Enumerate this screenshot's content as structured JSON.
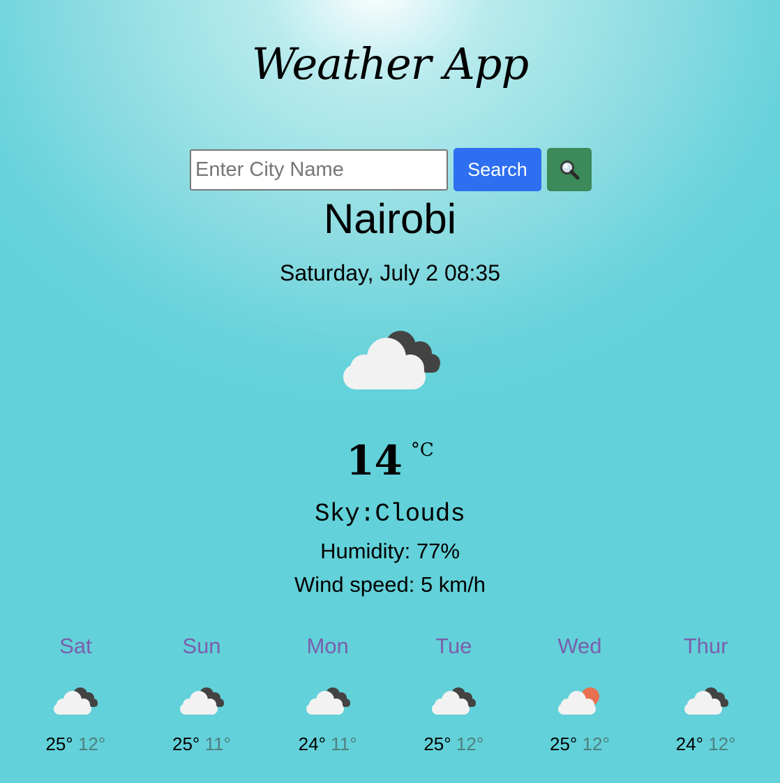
{
  "app": {
    "title": "Weather App"
  },
  "search": {
    "placeholder": "Enter City Name",
    "value": "",
    "button_label": "Search",
    "location_icon": "magnifier-icon"
  },
  "current": {
    "city": "Nairobi",
    "datetime": "Saturday, July 2 08:35",
    "icon": "cloudy-icon",
    "temperature": "14",
    "unit": "°C",
    "sky": "Sky:Clouds",
    "humidity": "Humidity: 77%",
    "wind": "Wind speed: 5 km/h"
  },
  "forecast": [
    {
      "day": "Sat",
      "icon": "cloudy-icon",
      "high": "25°",
      "low": "12°"
    },
    {
      "day": "Sun",
      "icon": "cloudy-icon",
      "high": "25°",
      "low": "11°"
    },
    {
      "day": "Mon",
      "icon": "cloudy-icon",
      "high": "24°",
      "low": "11°"
    },
    {
      "day": "Tue",
      "icon": "cloudy-icon",
      "high": "25°",
      "low": "12°"
    },
    {
      "day": "Wed",
      "icon": "partly-sunny-icon",
      "high": "25°",
      "low": "12°"
    },
    {
      "day": "Thur",
      "icon": "cloudy-icon",
      "high": "24°",
      "low": "12°"
    }
  ],
  "colors": {
    "search_button": "#2d6ff0",
    "location_button": "#3c8a5a",
    "day_name": "#7b5fad",
    "low_temp": "#4e7f7f",
    "background": "#62d1d9"
  }
}
